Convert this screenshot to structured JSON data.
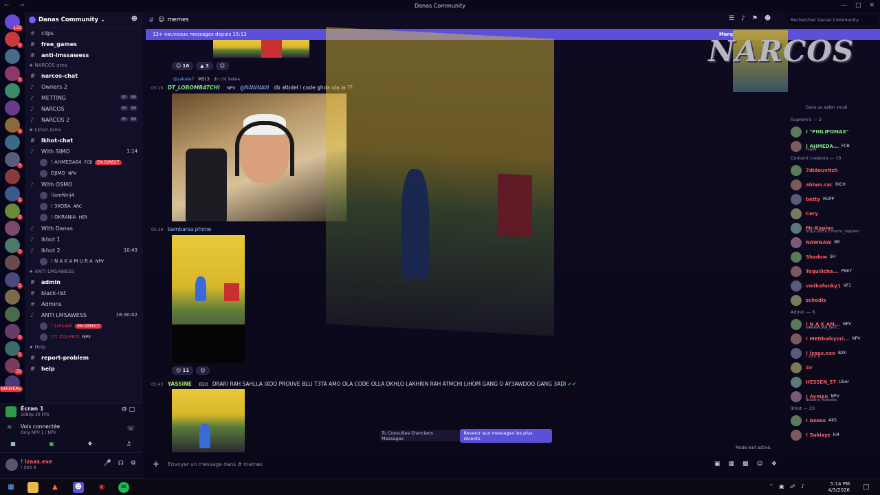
{
  "window": {
    "title": "Danas Community"
  },
  "server": {
    "name": "Danas Community"
  },
  "guilds": [
    {
      "badge": "133"
    },
    {
      "badge": "1"
    },
    {
      "badge": ""
    },
    {
      "badge": "1"
    },
    {
      "badge": ""
    },
    {
      "badge": ""
    },
    {
      "badge": "1"
    },
    {
      "badge": ""
    },
    {
      "badge": "1"
    },
    {
      "badge": ""
    },
    {
      "badge": "1"
    },
    {
      "badge": "1"
    },
    {
      "badge": ""
    },
    {
      "badge": "1"
    },
    {
      "badge": ""
    },
    {
      "badge": "1"
    },
    {
      "badge": ""
    },
    {
      "badge": ""
    },
    {
      "badge": "2"
    },
    {
      "badge": "1"
    },
    {
      "badge": "33"
    },
    {
      "badge": "NOUVEAU"
    }
  ],
  "channels_top": [
    {
      "name": "clips",
      "unread": false
    },
    {
      "name": "free_games",
      "unread": true
    },
    {
      "name": "anti-lmssawess",
      "unread": true
    }
  ],
  "cat_narcos": "NARCOS area",
  "channels_narcos": [
    {
      "name": "narcos-chat",
      "unread": true,
      "right": ""
    },
    {
      "name": "Owners 2",
      "unread": false,
      "right": ""
    },
    {
      "name": "METTING",
      "unread": false,
      "right": "00 99"
    },
    {
      "name": "NARCOS",
      "unread": false,
      "right": "00 99"
    },
    {
      "name": "NARCOS 2",
      "unread": false,
      "right": "00 99"
    }
  ],
  "cat_lkhot": "Lkhot Area",
  "lkhot_chat": "lkhot-chat",
  "with_simo": {
    "name": "With SIMO",
    "time": "1:14"
  },
  "simo_users": [
    {
      "name": "! AHMEDA64",
      "tag": "FCB",
      "live": "EN DIRECT"
    },
    {
      "name": "DJIMO",
      "tag": "NPV",
      "live": ""
    }
  ],
  "with_osmo": {
    "name": "With OSMO"
  },
  "osmo_users": [
    {
      "name": "!iamNinj4",
      "tag": ""
    },
    {
      "name": "! 3KOBA",
      "tag": "ARC"
    },
    {
      "name": "! OKRANIA",
      "tag": "HER"
    }
  ],
  "with_danas": {
    "name": "With Danas"
  },
  "lkhot_voice": [
    {
      "name": "lkhot 1",
      "time": ""
    },
    {
      "name": "lkhot 2",
      "time": "10:43"
    }
  ],
  "lkhot2_user": {
    "name": "! N A K A M U R A",
    "tag": "NPV"
  },
  "cat_anti": "ANTI LMSAWESS",
  "channels_anti": [
    {
      "name": "admin",
      "unread": true
    },
    {
      "name": "black-list",
      "unread": false
    },
    {
      "name": "Admins",
      "unread": false
    }
  ],
  "anti_voice": {
    "name": "ANTI LMSAWESS",
    "time": "16:30:02"
  },
  "anti_users": [
    {
      "name": "! Lmsawi",
      "live": "EN DIRECT"
    },
    {
      "name": "DT ZOLFRIX",
      "tag": "NPV"
    }
  ],
  "cat_help": "Help",
  "channels_help": [
    {
      "name": "report-problem"
    },
    {
      "name": "help"
    }
  ],
  "stream": {
    "title": "Écran 1",
    "quality": "1080p 30 FPS"
  },
  "voice": {
    "status": "Voix connectée",
    "where": "Only NPV 1 / NPV"
  },
  "user": {
    "name": "! Izaax.exe",
    "sub": "! XXX X"
  },
  "channel": {
    "name": "memes"
  },
  "new_messages": {
    "text": "13+ nouveaux messages depuis 15:13",
    "mark": "Marq"
  },
  "reactions1": {
    "a": "16",
    "b": "3"
  },
  "reply": {
    "user": "@zakaiw7",
    "tag": "MS13",
    "text": "dir chi 9alwa"
  },
  "msg1": {
    "time": "05:16",
    "author": "DT_LOBOMBATCHI",
    "tag": "NPV",
    "mention": "@NAWNAW",
    "text": "db atbdel l code ghda ola la ??"
  },
  "msg2": {
    "time": "05:39",
    "author": "bambarsa phone"
  },
  "reactions2": {
    "a": "11"
  },
  "msg3": {
    "time": "05:43",
    "author": "YASSINE",
    "tag": "EGO",
    "text": "DRARI RAH SAHLLA IXDO PROUVE BLLI T3TA AMO OLA CODE OLLA DKHLO LAKHRIN RAH ATMCHI LIHOM GANG O AY3AWDOO GANG 3ADI"
  },
  "narcos_logo": "NARCOS",
  "members_top": {
    "sub": "Dans un salon vocal"
  },
  "member_groups": [
    {
      "label": "Suprem's — 2",
      "members": [
        {
          "name": "! \"PHILIPOMAX\"",
          "color": "#7ee787",
          "tag": "",
          "sub": ""
        },
        {
          "name": "! AHMEDA...",
          "color": "#7ee787",
          "tag": "FCB",
          "sub": "FiveM"
        }
      ]
    },
    {
      "label": "Content creators — 10",
      "members": [
        {
          "name": "7didouvitch",
          "color": "#ff5c5c",
          "tag": "",
          "sub": ""
        },
        {
          "name": "ahlam.rac",
          "color": "#ff5c5c",
          "tag": "RICH",
          "sub": ""
        },
        {
          "name": "betty",
          "color": "#ff5c5c",
          "tag": "RGPP",
          "sub": ""
        },
        {
          "name": "Cery",
          "color": "#ff5c5c",
          "tag": "",
          "sub": ""
        },
        {
          "name": "Mr-Kaplan",
          "color": "#ff5c5c",
          "tag": "",
          "sub": "https://kick.com/mr_kaplann"
        },
        {
          "name": "NAWNAW",
          "color": "#ff5c5c",
          "tag": "BR",
          "sub": ""
        },
        {
          "name": "Shadow",
          "color": "#ff5c5c",
          "tag": "SH",
          "sub": ""
        },
        {
          "name": "Tequilicha...",
          "color": "#ff5c5c",
          "tag": "PNKY",
          "sub": ""
        },
        {
          "name": "vodkafunky1",
          "color": "#ff5c5c",
          "tag": "VF1",
          "sub": ""
        },
        {
          "name": "zchodis",
          "color": "#ff5c5c",
          "tag": "",
          "sub": ""
        }
      ]
    },
    {
      "label": "Admin — 6",
      "members": [
        {
          "name": "! N A K AM...",
          "color": "#ff5c5c",
          "tag": "NPV",
          "sub": "NAKAMURA_NPV..."
        },
        {
          "name": "! MEDbaikyori...",
          "color": "#ff5c5c",
          "tag": "NPV",
          "sub": ""
        },
        {
          "name": "! Izaax.exe",
          "color": "#ff5c5c",
          "tag": "B2K",
          "sub": "! XXX X"
        },
        {
          "name": "4v",
          "color": "#ff5c5c",
          "tag": "",
          "sub": ""
        },
        {
          "name": "HESSEN_57",
          "color": "#ff5c5c",
          "tag": "USer",
          "sub": ""
        },
        {
          "name": "! Aymen",
          "color": "#ff5c5c",
          "tag": "NPV",
          "sub": "Bobony Roleplay"
        }
      ]
    },
    {
      "label": "lkhot — 20",
      "members": [
        {
          "name": "! Anass",
          "color": "#ff6b8a",
          "tag": "AKS",
          "sub": ""
        },
        {
          "name": "! Sukixyz",
          "color": "#ff6b8a",
          "tag": "ki4",
          "sub": ""
        }
      ]
    }
  ],
  "search": {
    "placeholder": "Rechercher Danas Community"
  },
  "old_messages": {
    "text": "Tu Consultes D'anciens Messages",
    "button": "Revenir aux messages les plus récents"
  },
  "slowmode": "Mode lent activé.",
  "composer": {
    "placeholder": "Envoyer un message dans # memes"
  },
  "taskbar": {
    "time": "5:14 PM",
    "date": "4/3/2026"
  }
}
